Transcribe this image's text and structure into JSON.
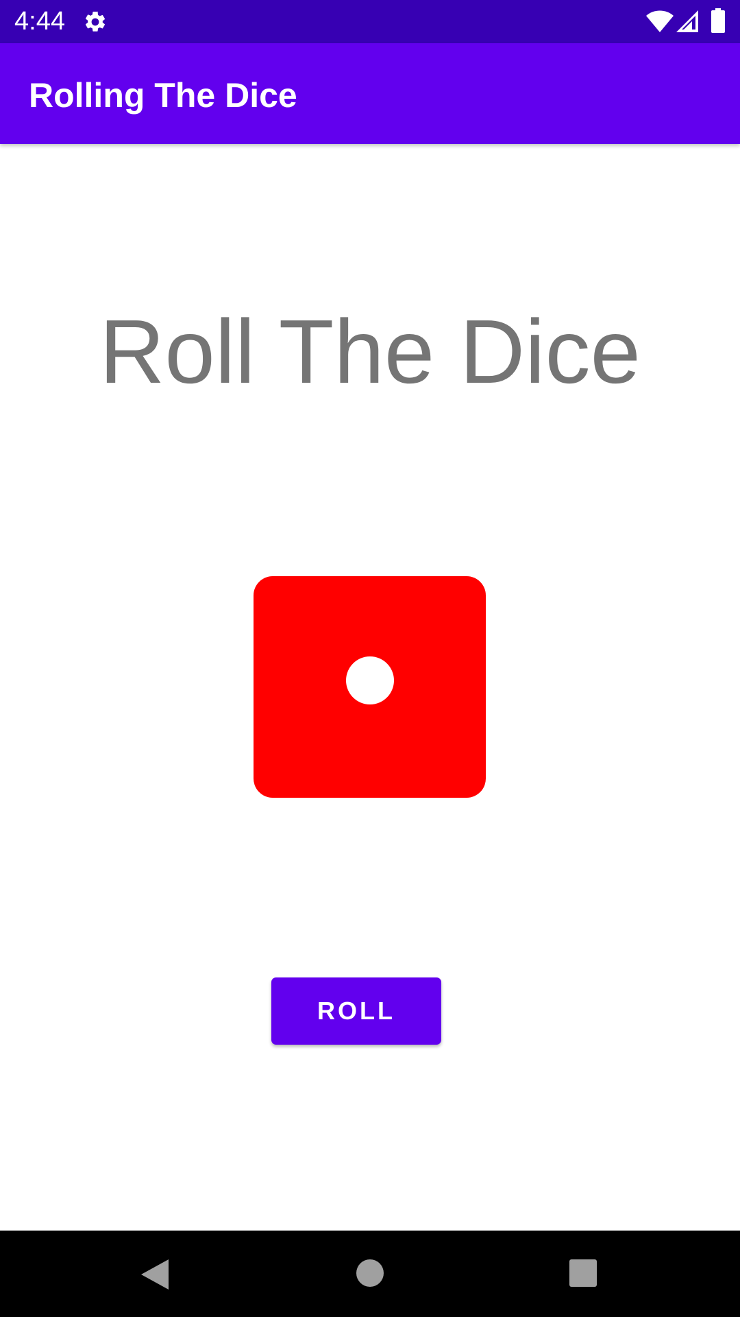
{
  "status_bar": {
    "time": "4:44",
    "icons": [
      "gear-icon",
      "wifi-icon",
      "signal-icon",
      "battery-icon"
    ],
    "background": "#3700b3"
  },
  "app_bar": {
    "title": "Rolling The Dice",
    "background": "#6200ee"
  },
  "main": {
    "heading": "Roll The Dice",
    "dice": {
      "face_value": 1,
      "color": "#ff0000",
      "pip_color": "#ffffff"
    },
    "roll_button": {
      "label": "ROLL",
      "color": "#6200ee"
    }
  },
  "nav_bar": {
    "icons": [
      "back-icon",
      "home-icon",
      "recents-icon"
    ]
  }
}
